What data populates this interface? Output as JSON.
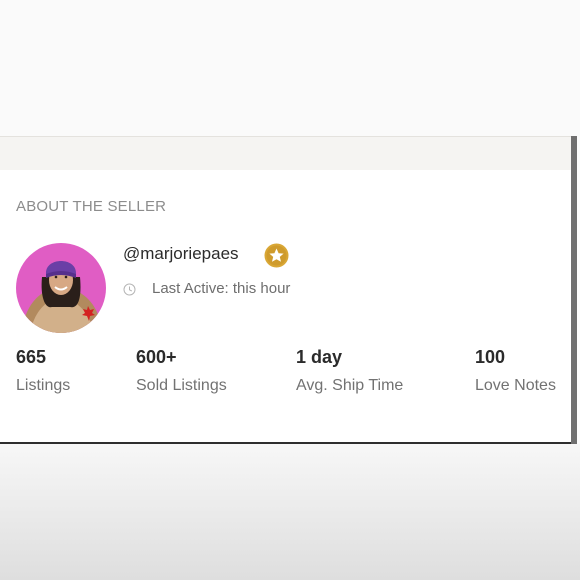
{
  "seller": {
    "section_title": "ABOUT THE SELLER",
    "username": "@marjoriepaes",
    "last_active": "Last Active: this hour",
    "badge_icon": "star-badge-icon",
    "badge_color": "#d9a735"
  },
  "stats": [
    {
      "value": "665",
      "label": "Listings"
    },
    {
      "value": "600+",
      "label": "Sold Listings"
    },
    {
      "value": "1 day",
      "label": "Avg. Ship Time"
    },
    {
      "value": "100",
      "label": "Love Notes"
    }
  ]
}
